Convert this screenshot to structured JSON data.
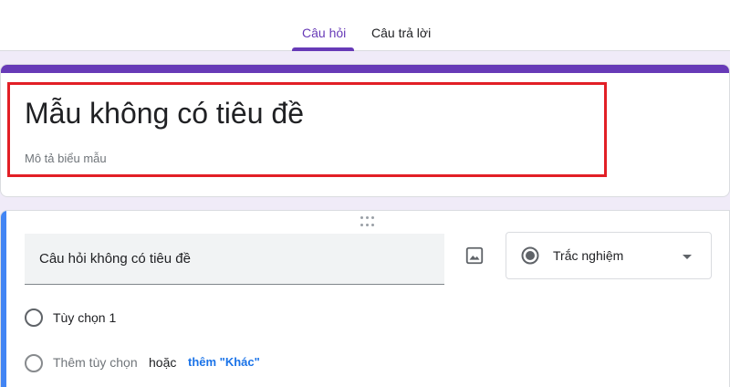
{
  "tabs": [
    {
      "label": "Câu hỏi",
      "active": true
    },
    {
      "label": "Câu trả lời",
      "active": false
    }
  ],
  "form": {
    "title": "Mẫu không có tiêu đề",
    "description_placeholder": "Mô tả biểu mẫu"
  },
  "question": {
    "title": "Câu hỏi không có tiêu đề",
    "type": "Trắc nghiệm",
    "options": [
      {
        "label": "Tùy chọn 1"
      }
    ],
    "add_option_label": "Thêm tùy chọn",
    "or_label": "hoặc",
    "add_other_label": "thêm \"Khác\""
  },
  "colors": {
    "accent": "#673ab7",
    "question_accent": "#4285f4",
    "highlight": "#e21f26",
    "link": "#1a73e8",
    "background": "#f0ebf8"
  },
  "icons": {
    "drag": "drag-handle-icon",
    "image": "image-icon",
    "type": "radio-button-checked-icon",
    "dropdown": "arrow-drop-down-icon"
  }
}
